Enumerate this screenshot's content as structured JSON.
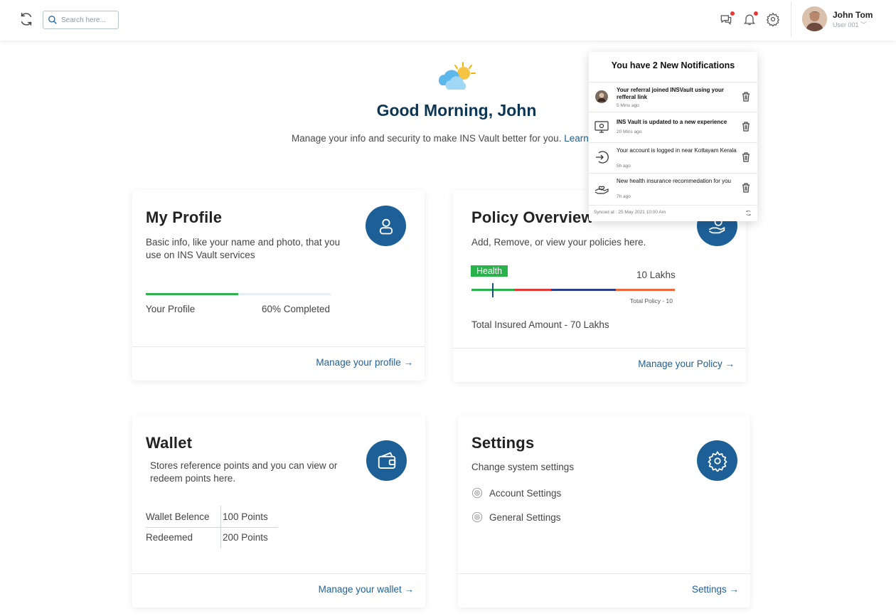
{
  "header": {
    "search_placeholder": "Search here...",
    "user_name": "John Tom",
    "user_role": "User 001 ﹀",
    "icons": [
      "refresh-icon",
      "search-icon",
      "chat-icon",
      "bell-icon",
      "gear-icon"
    ],
    "accent_color": "#1d5f97",
    "badge_color": "#e53935"
  },
  "greeting": {
    "title": "Good Morning, John",
    "subtitle": "Manage your info and security to make INS Vault better for you. ",
    "learn_more": "Learn"
  },
  "profile_card": {
    "title": "My Profile",
    "description": "Basic info, like your name and photo, that you use on INS Vault services",
    "progress_label": "Your Profile",
    "progress_text": "60% Completed",
    "progress_value": 0.5,
    "link": "Manage your profile →",
    "icon": "user-icon"
  },
  "policy_card": {
    "title": "Policy Overview",
    "description": "Add, Remove, or view your policies here.",
    "badge": "Health",
    "amount": "10 Lakhs",
    "total_policy": "Total Policy - 10",
    "total_insured": "Total Insured Amount - 70 Lakhs",
    "link": "Manage your Policy →",
    "icon": "hand-money-icon",
    "bar_segments": [
      {
        "color": "#29b34a",
        "fraction": 0.21
      },
      {
        "color": "#e53935",
        "fraction": 0.18
      },
      {
        "color": "#2a3f8f",
        "fraction": 0.32
      },
      {
        "color": "#f0653a",
        "fraction": 0.29
      }
    ],
    "marker_fraction": 0.1
  },
  "wallet_card": {
    "title": "Wallet",
    "description": "Stores reference points and you can view or redeem points here.",
    "rows": [
      {
        "label": "Wallet Belence",
        "value": "100 Points"
      },
      {
        "label": "Redeemed",
        "value": "200 Points"
      }
    ],
    "link": "Manage your wallet →",
    "icon": "wallet-icon"
  },
  "settings_card": {
    "title": "Settings",
    "description": "Change system settings",
    "items": [
      "Account Settings",
      "General Settings"
    ],
    "link": "Settings →",
    "icon": "gear-icon"
  },
  "notifications": {
    "title": "You have 2 New Notifications",
    "items": [
      {
        "text": "Your referral joined INSVault using your refferal link",
        "time": "5 Mins ago",
        "icon": "user-photo-icon",
        "unread": true
      },
      {
        "text": "INS Vault is updated to a new experience",
        "time": "20 Mins ago",
        "icon": "monitor-icon",
        "unread": true
      },
      {
        "text": "Your account is logged in near Kottayam Kerala",
        "time": "5h ago",
        "icon": "login-icon",
        "unread": false
      },
      {
        "text": "New health insurance recommedation for you",
        "time": "7h ago",
        "icon": "health-hand-icon",
        "unread": false
      }
    ],
    "synced": "Synced at :  25 May 2021 10:00 Am"
  }
}
